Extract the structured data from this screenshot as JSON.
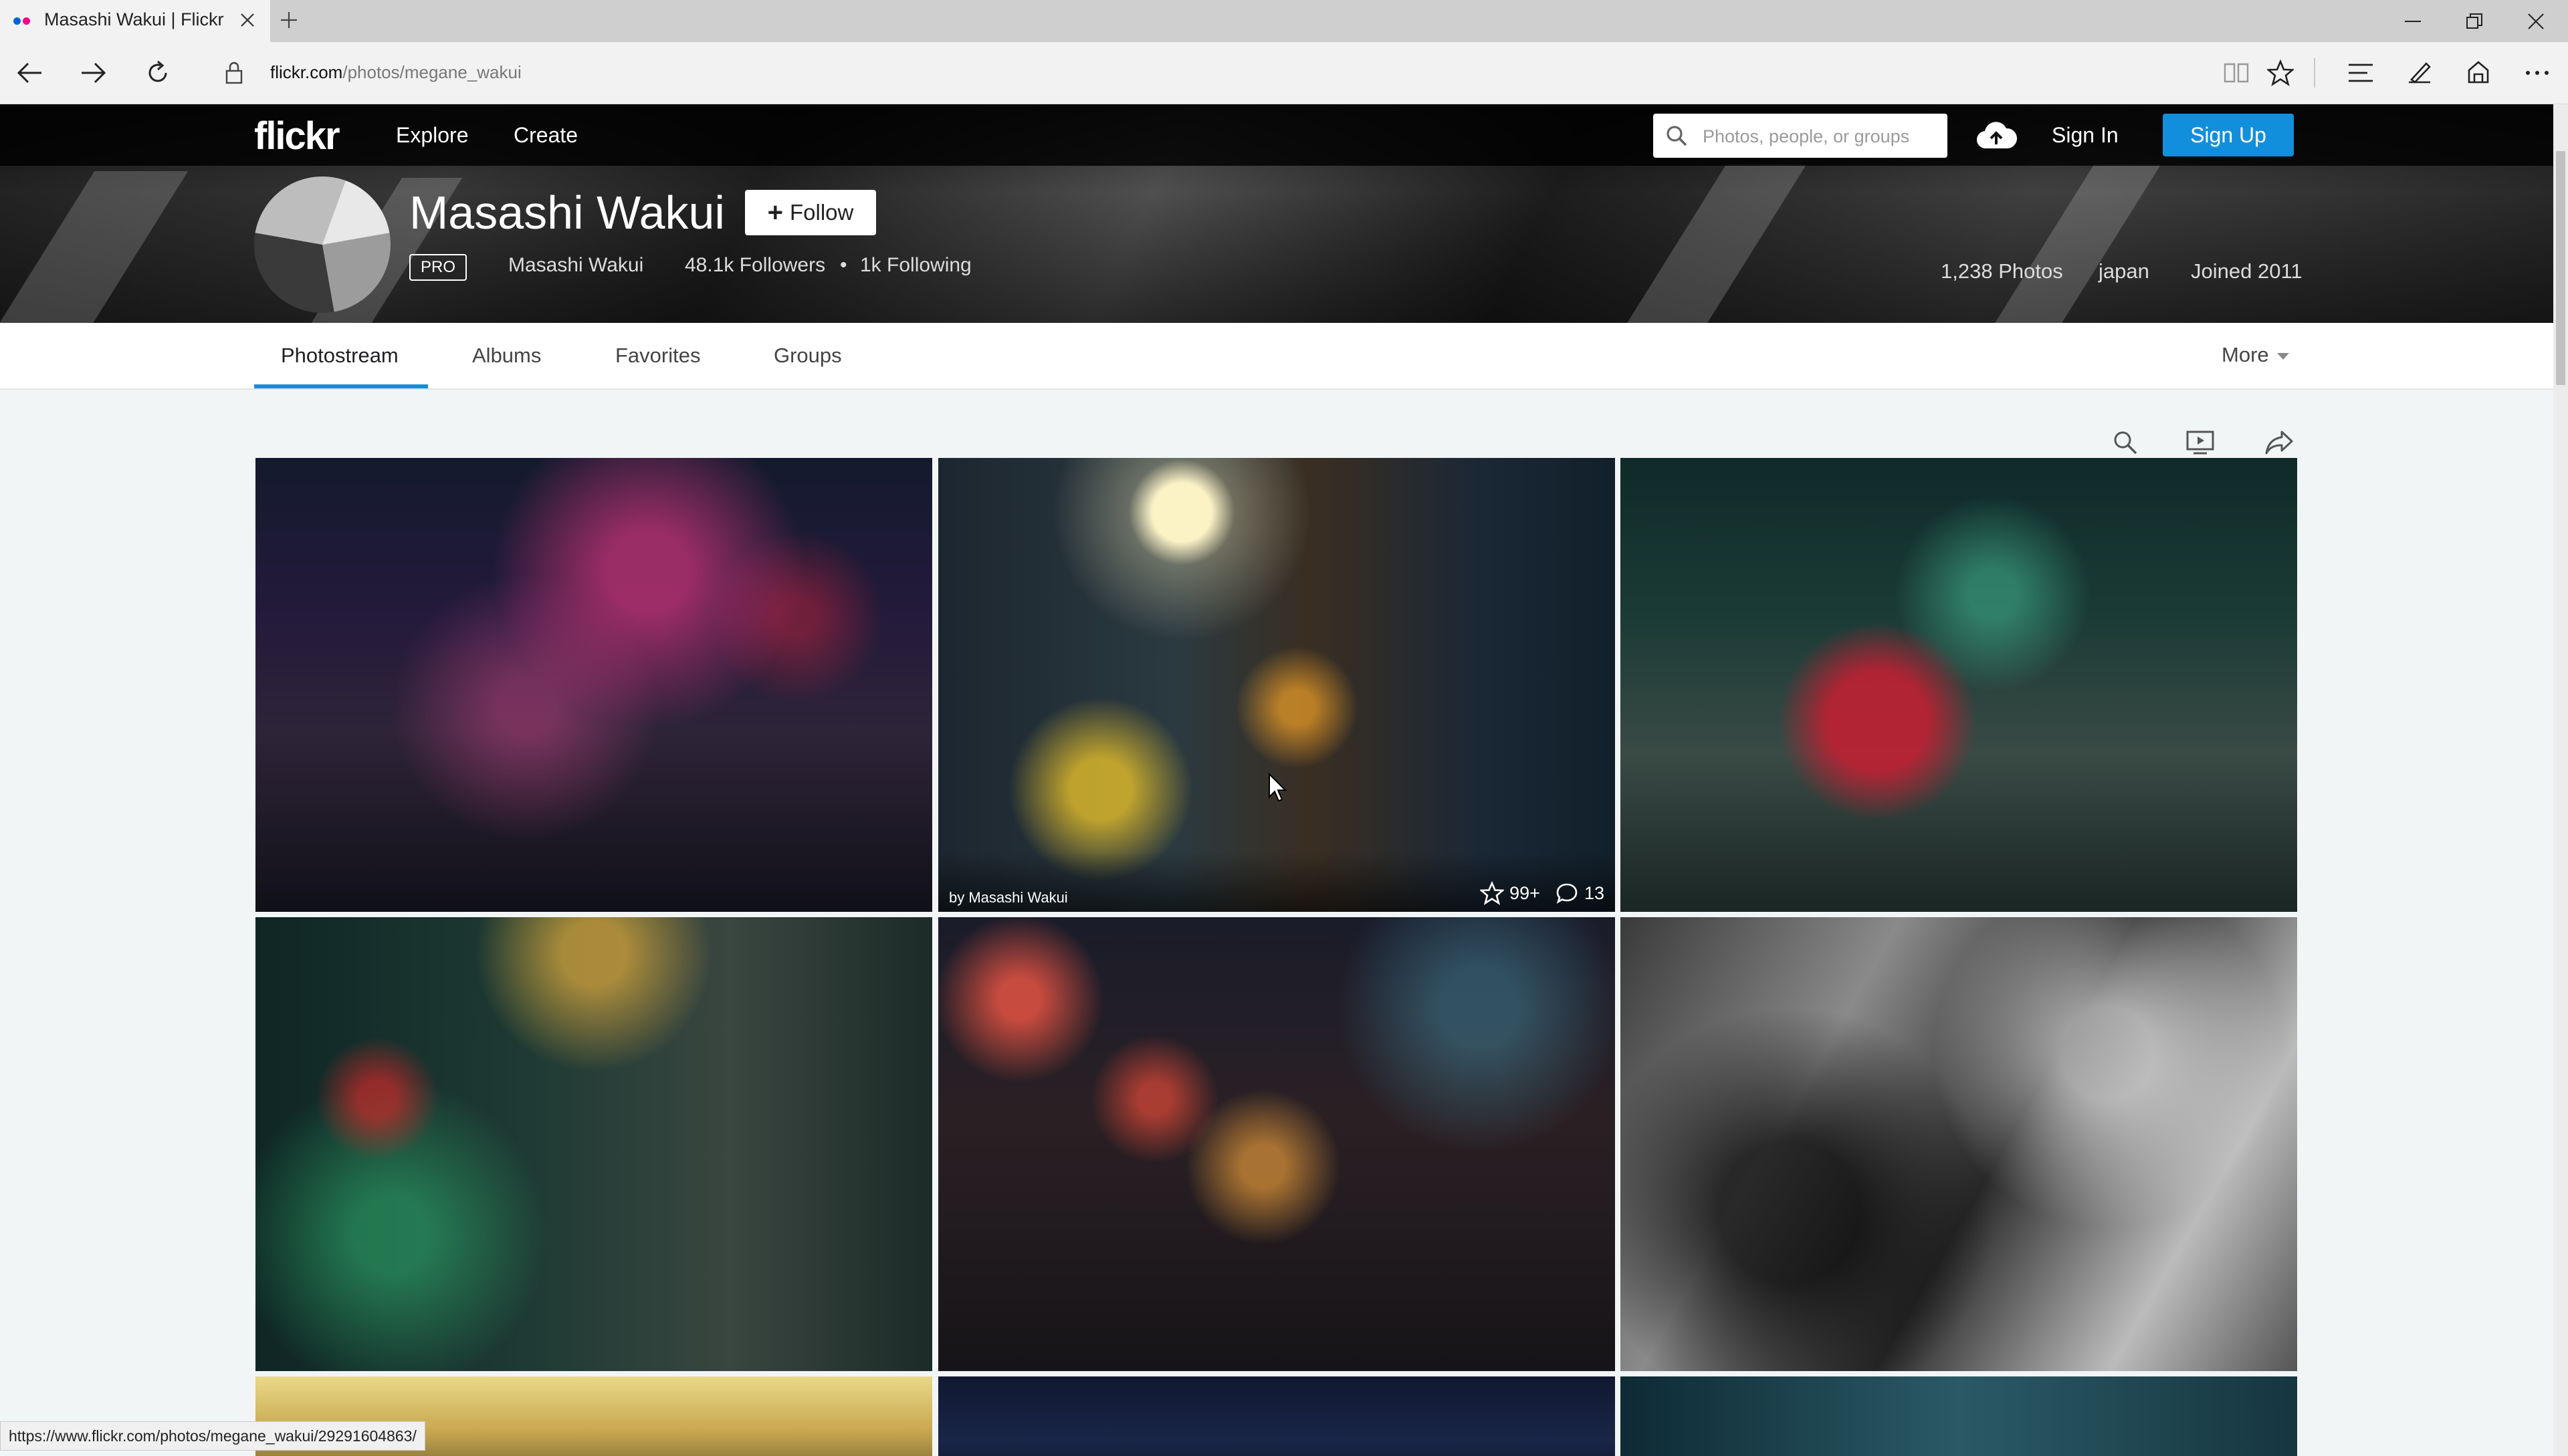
{
  "browser": {
    "tab_title": "Masashi Wakui | Flickr",
    "url_domain": "flickr.com",
    "url_path": "/photos/megane_wakui",
    "status_url": "https://www.flickr.com/photos/megane_wakui/29291604863/"
  },
  "nav": {
    "logo": "flickr",
    "explore": "Explore",
    "create": "Create",
    "search_placeholder": "Photos, people, or groups",
    "sign_in": "Sign In",
    "sign_up": "Sign Up"
  },
  "profile": {
    "display_name": "Masashi Wakui",
    "follow_label": "Follow",
    "pro_badge": "PRO",
    "real_name": "Masashi Wakui",
    "followers": "48.1k Followers",
    "bullet": "•",
    "following": "1k Following",
    "photos_count": "1,238 Photos",
    "location": "japan",
    "joined": "Joined 2011"
  },
  "subnav": {
    "tabs": [
      "Photostream",
      "Albums",
      "Favorites",
      "Groups"
    ],
    "more": "More"
  },
  "photos": [
    {
      "author": "",
      "faves": "",
      "comments": ""
    },
    {
      "author": "by Masashi Wakui",
      "faves": "99+",
      "comments": "13"
    },
    {
      "author": "",
      "faves": "",
      "comments": ""
    },
    {
      "author": "",
      "faves": "",
      "comments": ""
    },
    {
      "author": "",
      "faves": "",
      "comments": ""
    },
    {
      "author": "",
      "faves": "",
      "comments": ""
    }
  ],
  "icons": {
    "back": "back-arrow-icon",
    "forward": "forward-arrow-icon",
    "refresh": "refresh-icon",
    "lock": "lock-icon",
    "reading": "reading-view-icon",
    "favorite": "star-icon",
    "hub": "hub-icon",
    "notes": "web-note-icon",
    "share": "share-icon",
    "more": "more-dots-icon",
    "upload": "cloud-upload-icon",
    "slideshow": "slideshow-icon"
  },
  "colors": {
    "accent": "#128fdc",
    "nav_bg": "#000000",
    "flickr_blue": "#0063dc",
    "flickr_pink": "#ff0084"
  }
}
